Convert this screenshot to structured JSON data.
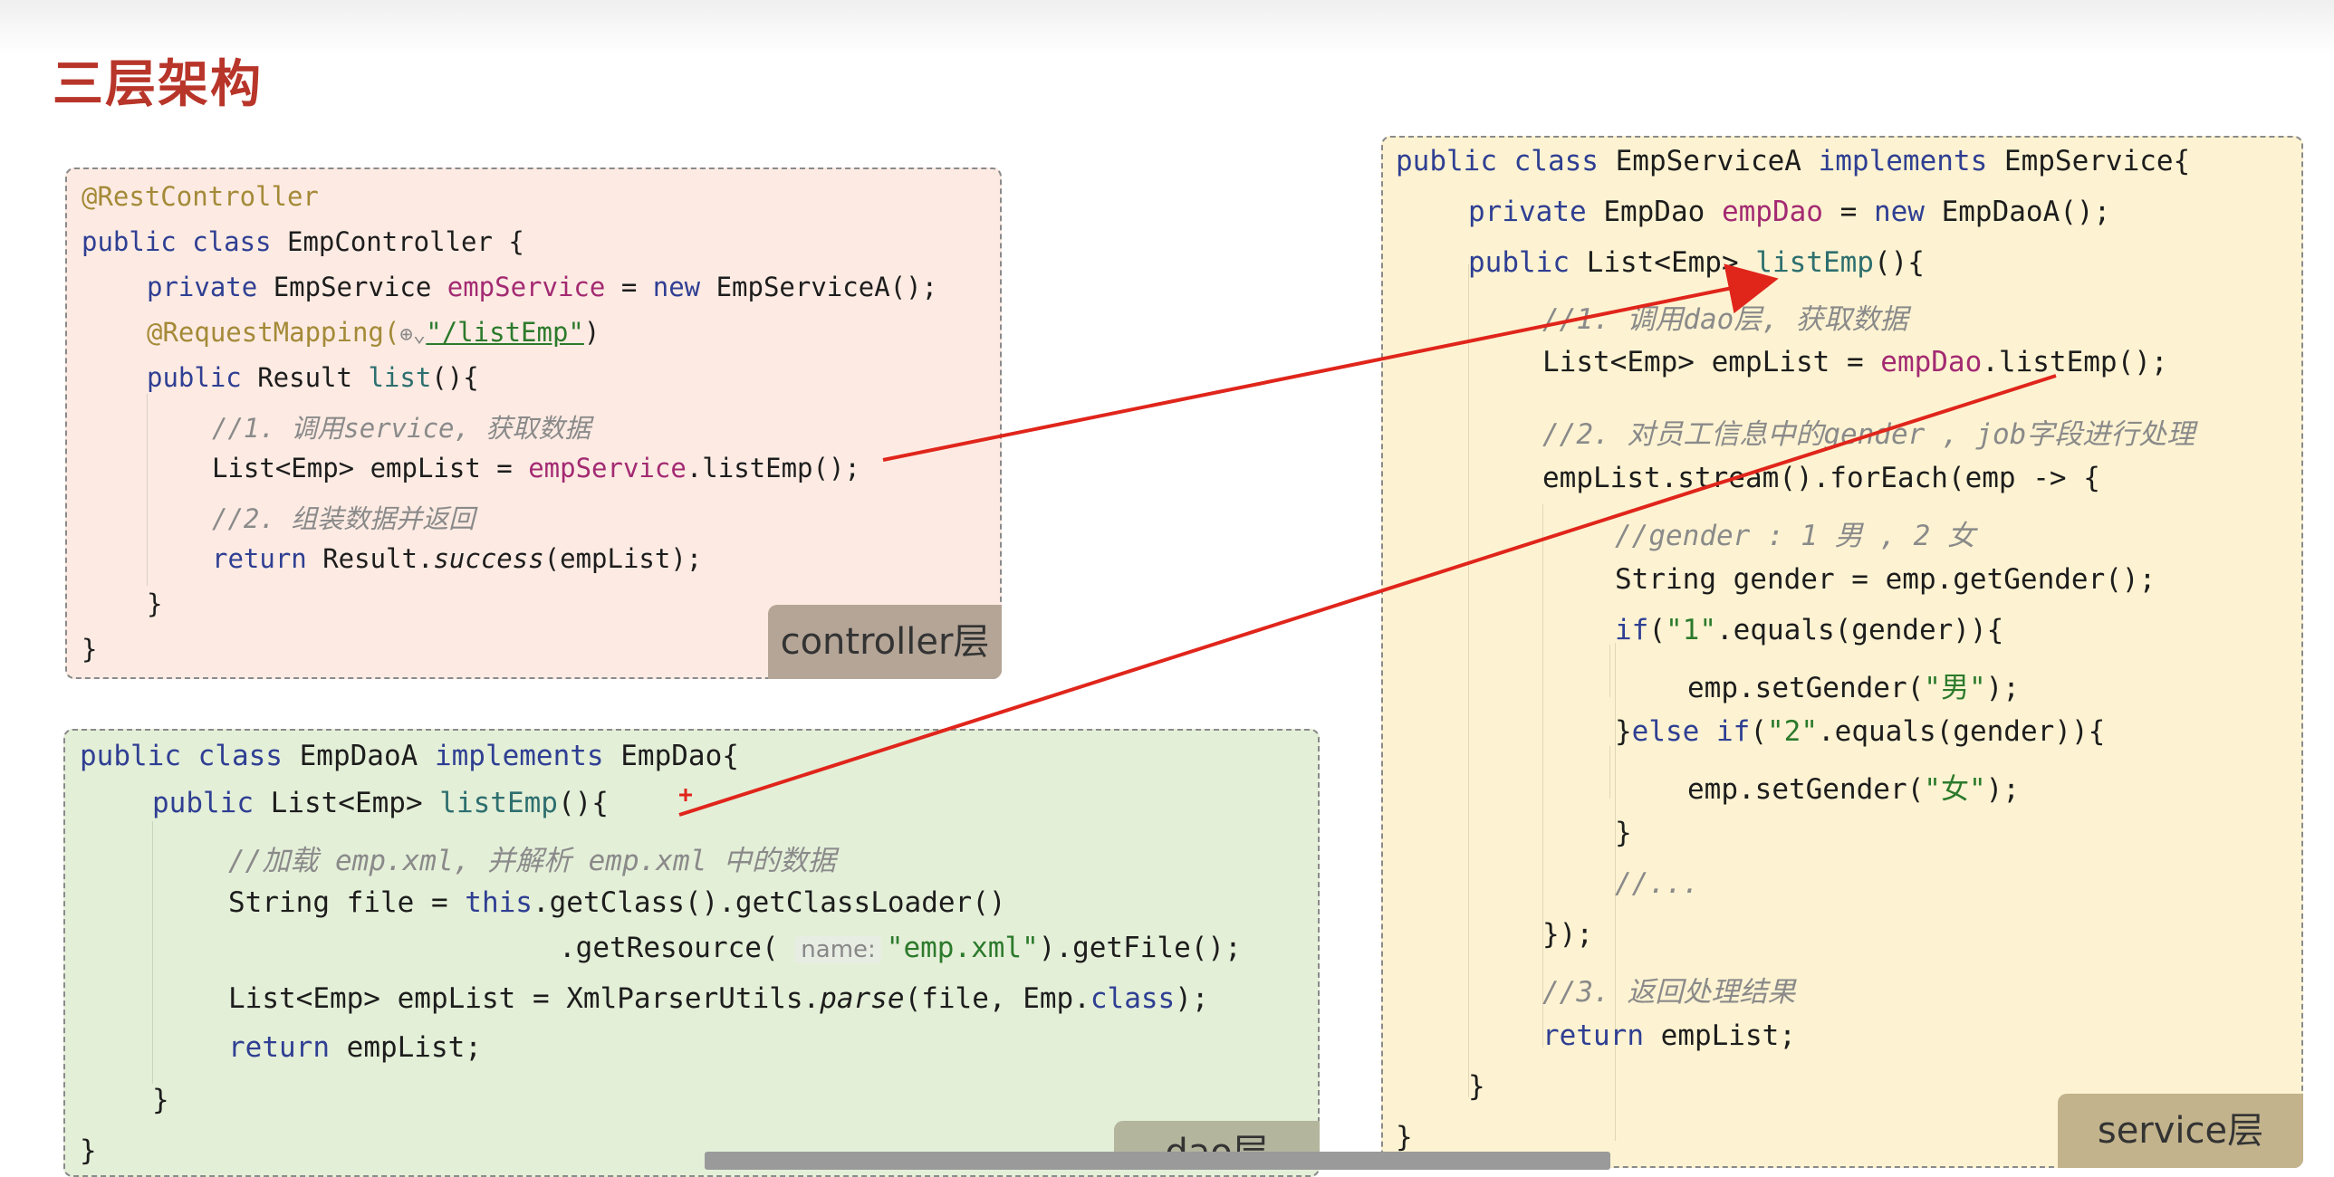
{
  "page": {
    "title": "三层架构"
  },
  "controller": {
    "layer_label": "controller层",
    "lines": {
      "l1": "@RestController",
      "l2a": "public class ",
      "l2b": "EmpController {",
      "l3a": "private ",
      "l3b": "EmpService ",
      "l3c": "empService",
      "l3d": " = ",
      "l3e": "new ",
      "l3f": "EmpServiceA();",
      "l4a": "@RequestMapping(",
      "l4b": "\"/listEmp\"",
      "l4c": ")",
      "l5a": "public ",
      "l5b": "Result ",
      "l5c": "list",
      "l5d": "(){",
      "l6": "//1. 调用service, 获取数据",
      "l7a": "List<Emp> empList = ",
      "l7b": "empService",
      "l7c": ".listEmp();",
      "l8": "//2. 组装数据并返回",
      "l9a": "return ",
      "l9b": "Result.",
      "l9c": "success",
      "l9d": "(empList);",
      "l10": "}",
      "l11": "}"
    }
  },
  "dao": {
    "layer_label": "dao层",
    "lines": {
      "l1a": "public class ",
      "l1b": "EmpDaoA ",
      "l1c": "implements ",
      "l1d": "EmpDao{",
      "l2a": "public ",
      "l2b": "List<Emp> ",
      "l2c": "listEmp",
      "l2d": "(){",
      "l3": "//加载 emp.xml, 并解析 emp.xml 中的数据",
      "l4a": "String file = ",
      "l4b": "this",
      "l4c": ".getClass().getClassLoader()",
      "l5a": ".getResource( ",
      "l5hint": "name:",
      "l5b": "\"emp.xml\"",
      "l5c": ").getFile();",
      "l6a": "List<Emp> empList = XmlParserUtils.",
      "l6b": "parse",
      "l6c": "(file, Emp.",
      "l6d": "class",
      "l6e": ");",
      "l7a": "return ",
      "l7b": "empList;",
      "l8": "}",
      "l9": "}"
    }
  },
  "service": {
    "layer_label": "service层",
    "lines": {
      "l1a": "public class ",
      "l1b": "EmpServiceA ",
      "l1c": "implements ",
      "l1d": "EmpService{",
      "l2a": "private ",
      "l2b": "EmpDao ",
      "l2c": "empDao",
      "l2d": " = ",
      "l2e": "new ",
      "l2f": "EmpDaoA();",
      "l3a": "public ",
      "l3b": "List<Emp> ",
      "l3c": "listEmp",
      "l3d": "(){",
      "l4": "//1. 调用dao层, 获取数据",
      "l5a": "List<Emp> empList = ",
      "l5b": "empDao",
      "l5c": ".listEmp();",
      "l6": "//2. 对员工信息中的gender , job字段进行处理",
      "l7": "empList.stream().forEach(emp -> {",
      "l8": "//gender : 1 男 , 2 女",
      "l9": "String gender = emp.getGender();",
      "l10a": "if",
      "l10b": "(",
      "l10c": "\"1\"",
      "l10d": ".equals(gender)){",
      "l11a": "emp.setGender(",
      "l11b": "\"男\"",
      "l11c": ");",
      "l12a": "}",
      "l12b": "else if",
      "l12c": "(",
      "l12d": "\"2\"",
      "l12e": ".equals(gender)){",
      "l13a": "emp.setGender(",
      "l13b": "\"女\"",
      "l13c": ");",
      "l14": "}",
      "l15": "//...",
      "l16": "});",
      "l17": "//3. 返回处理结果",
      "l18a": "return ",
      "l18b": "empList;",
      "l19": "}",
      "l20": "}"
    }
  },
  "colors": {
    "title": "#b8352a",
    "arrow": "#e0251b",
    "controller_bg": "#fdebe3",
    "dao_bg": "#e4efd8",
    "service_bg": "#fdf3d2"
  }
}
